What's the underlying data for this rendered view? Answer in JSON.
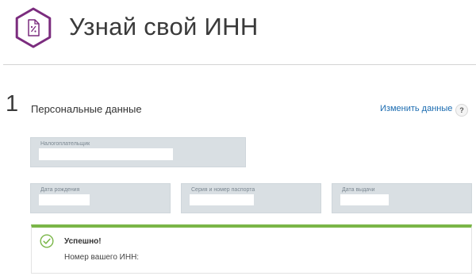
{
  "header": {
    "title": "Узнай свой ИНН",
    "logo_icon": "tax-percent-document-icon",
    "logo_color": "#7b2c7e"
  },
  "section": {
    "step_number": "1",
    "title": "Персональные данные",
    "edit_link": "Изменить данные",
    "help_label": "?"
  },
  "form": {
    "taxpayer": {
      "label": "Налогоплательщик",
      "value": ""
    },
    "birth_date": {
      "label": "Дата рождения",
      "value": ""
    },
    "passport": {
      "label": "Серия и номер паспорта",
      "value": ""
    },
    "issue_date": {
      "label": "Дата выдачи",
      "value": ""
    }
  },
  "result": {
    "title": "Успешно!",
    "text": "Номер вашего ИНН:",
    "accent_color": "#7ab648",
    "icon": "check-circle-icon"
  },
  "colors": {
    "link": "#1a6bb0",
    "field_bg": "#d9dfe3"
  }
}
